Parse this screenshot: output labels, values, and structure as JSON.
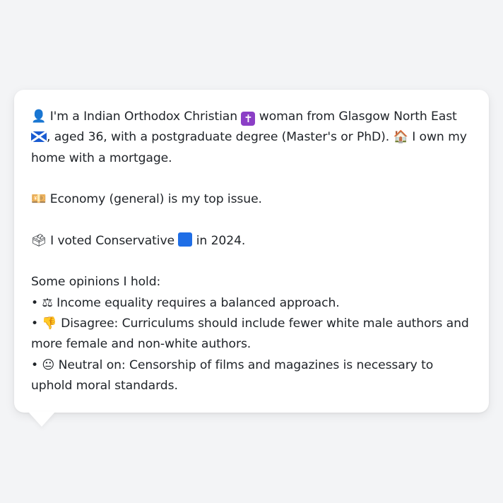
{
  "card": {
    "lines": {
      "intro_a": "I'm a Indian Orthodox Christian",
      "intro_b": "woman from Glasgow North East",
      "intro_c": ", aged 36, with a postgraduate degree (Master's or PhD).",
      "intro_d": "I own my home with a mortgage.",
      "issue": "Economy (general) is my top issue.",
      "vote_a": "I voted Conservative",
      "vote_b": "in 2024.",
      "opinions_header": "Some opinions I hold:",
      "opinion_1": "Income equality requires a balanced approach.",
      "opinion_2": "Disagree: Curriculums should include fewer white male authors and more female and non-white authors.",
      "opinion_3": "Neutral on: Censorship of films and magazines is necessary to uphold moral standards."
    },
    "icons": {
      "person": "👤",
      "cross": "✝",
      "flag": "scotland-flag-icon",
      "house": "🏠",
      "money": "💴",
      "ballot": "🗳",
      "square": "blue-square-icon",
      "scales": "⚖",
      "thumbs_down": "👎",
      "neutral_face": "😐",
      "bullet": "•"
    },
    "colors": {
      "background": "#f3f4f6",
      "card": "#ffffff",
      "text": "#1f2328",
      "conservative_blue": "#1f6ee6"
    }
  }
}
